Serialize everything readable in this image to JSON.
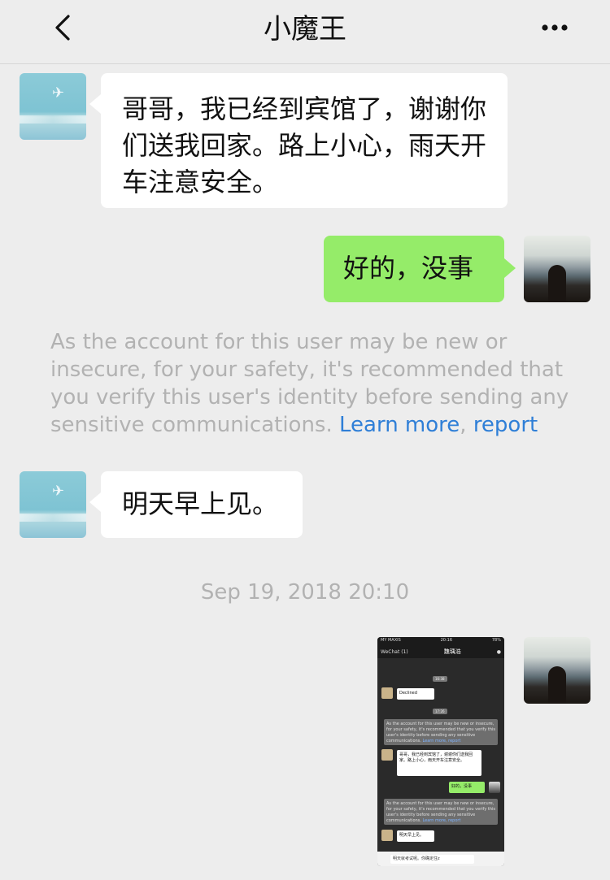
{
  "header": {
    "title": "小魔王"
  },
  "messages": [
    {
      "side": "left",
      "text": "哥哥，我已经到宾馆了，谢谢你们送我回家。路上小心，雨天开车注意安全。"
    },
    {
      "side": "right",
      "text": "好的，没事"
    },
    {
      "side": "left",
      "text": "明天早上见。"
    }
  ],
  "notice": {
    "text": "As the account for this user may be new or insecure, for your safety, it's recommended that you verify this user's identity before sending any sensitive communications.",
    "learn_more": "Learn more",
    "separator": ",",
    "report": "report"
  },
  "timestamp": "Sep 19, 2018 20:10",
  "screenshot": {
    "status_left": "MY MAXIS",
    "status_time": "20:16",
    "status_right": "78%",
    "nav_back": "WeChat (1)",
    "nav_title": "魏瑀浩",
    "time1": "16:38",
    "declined": "Declined",
    "time2": "17:26",
    "notice1": "As the account for this user may be new or insecure, for your safety, it's recommended that you verify this user's identity before sending any sensitive communications.",
    "notice_links": "Learn more, report",
    "msg1": "哥哥，我已经到宾馆了，谢谢你们送我回家。路上小心，雨天开车注意安全。",
    "msg2": "好的，没事",
    "notice2": "As the account for this user may be new or insecure, for your safety, it's recommended that you verify this user's identity before sending any sensitive communications.",
    "msg3": "明天早上见。",
    "input_text": "明天就考试呢。你确定住z"
  },
  "colors": {
    "background": "#ededed",
    "bubble_self": "#95ec69",
    "bubble_other": "#ffffff",
    "link": "#2f7fd7",
    "notice_text": "#b2b2b2"
  }
}
